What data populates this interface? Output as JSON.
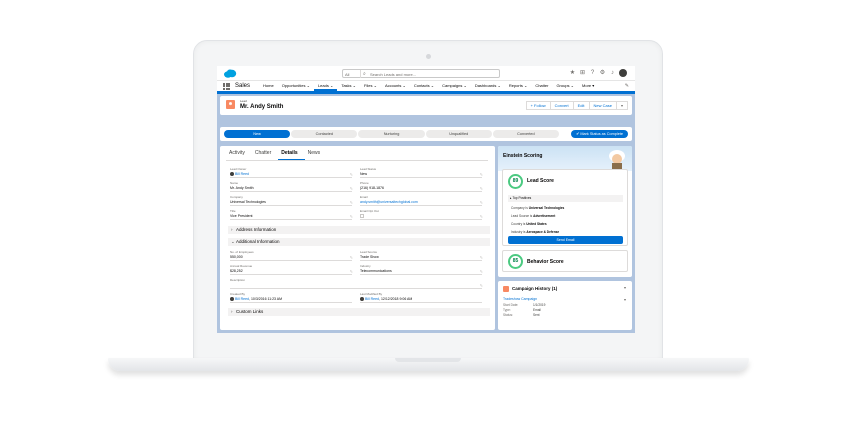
{
  "global_header": {
    "search_scope": "All",
    "search_placeholder": "Search Leads and more..."
  },
  "app_nav": {
    "app_name": "Sales",
    "items": [
      "Home",
      "Opportunities ⌄",
      "Leads ⌄",
      "Tasks ⌄",
      "Files ⌄",
      "Accounts ⌄",
      "Contacts ⌄",
      "Campaigns ⌄",
      "Dashboards ⌄",
      "Reports ⌄",
      "Chatter",
      "Groups ⌄",
      "More ▾"
    ],
    "active_index": 2
  },
  "record": {
    "type": "Lead",
    "name": "Mr. Andy Smith",
    "actions": [
      "+ Follow",
      "Convert",
      "Edit",
      "New Case"
    ]
  },
  "path": {
    "steps": [
      "New",
      "Contacted",
      "Nurturing",
      "Unqualified",
      "Converted"
    ],
    "current_index": 0,
    "complete_label": "✔ Mark Status as Complete"
  },
  "tabs": [
    "Activity",
    "Chatter",
    "Details",
    "News"
  ],
  "active_tab_index": 2,
  "fields": {
    "lead_owner": {
      "label": "Lead Owner",
      "value": "Bill Reed"
    },
    "lead_status": {
      "label": "Lead Status",
      "value": "New"
    },
    "name": {
      "label": "Name",
      "value": "Mr. Andy Smith"
    },
    "phone": {
      "label": "Phone",
      "value": "(216) 918-1876"
    },
    "company": {
      "label": "Company",
      "value": "Universal Technologies"
    },
    "email": {
      "label": "Email",
      "value": "andy.smith@universaltechglobal.com"
    },
    "title": {
      "label": "Title",
      "value": "Vice President"
    },
    "email_opt_out": {
      "label": "Email Opt Out"
    },
    "employees": {
      "label": "No. of Employees",
      "value": "550,000"
    },
    "lead_source": {
      "label": "Lead Source",
      "value": "Trade Show"
    },
    "revenue": {
      "label": "Annual Revenue",
      "value": "$28,252"
    },
    "industry": {
      "label": "Industry",
      "value": "Telecommunications"
    },
    "description": {
      "label": "Description",
      "value": ""
    },
    "created_by": {
      "label": "Created By",
      "user": "Bill Reed",
      "date": ", 10/3/2016 11:23 AM"
    },
    "modified_by": {
      "label": "Last Modified By",
      "user": "Bill Reed",
      "date": ", 12/12/2018 9:06 AM"
    }
  },
  "sections": {
    "address": "Address Information",
    "additional": "Additional Information",
    "custom_links": "Custom Links"
  },
  "einstein": {
    "title": "Einstein Scoring",
    "lead_score": {
      "value": "89",
      "label": "Lead Score"
    },
    "top_positives": "Top Positives",
    "factors": [
      {
        "text": "Company is ",
        "bold": "Universal Technologies"
      },
      {
        "text": "Lead Source is ",
        "bold": "Advertisement"
      },
      {
        "text": "Country is ",
        "bold": "United States"
      },
      {
        "text": "Industry is ",
        "bold": "Aerospace & Defense"
      }
    ],
    "send_email": "Send Email",
    "behavior_score": {
      "value": "85",
      "label": "Behavior Score"
    }
  },
  "campaign_history": {
    "title": "Campaign History (1)",
    "campaign_name": "Tradeshow Campaign",
    "rows": [
      {
        "label": "Start Date:",
        "value": "1/1/2019"
      },
      {
        "label": "Type:",
        "value": "Email"
      },
      {
        "label": "Status:",
        "value": "Sent"
      }
    ]
  },
  "colors": {
    "brand": "#0070d2",
    "lead_icon": "#f88962",
    "score_green": "#4bca81",
    "background": "#b0c4df"
  },
  "icons": [
    "salesforce-cloud-icon",
    "search-icon",
    "favorites-icon",
    "add-icon",
    "help-icon",
    "setup-gear-icon",
    "notifications-bell-icon",
    "app-launcher-icon",
    "edit-nav-icon",
    "lead-icon",
    "campaign-icon"
  ]
}
